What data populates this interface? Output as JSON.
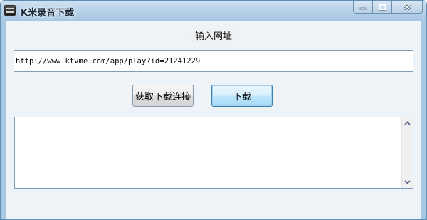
{
  "window": {
    "title": "K米录音下载",
    "icon": "app-icon"
  },
  "form": {
    "url_label": "输入网址",
    "url_value": "http://www.ktvme.com/app/play?id=21241229",
    "get_link_button": "获取下载连接",
    "download_button": "下载",
    "output_text": ""
  },
  "colors": {
    "titlebar": "#b6d1e9",
    "client_background": "#eef3f8",
    "input_border": "#7e9db9",
    "focused_button": "#bee6fd"
  }
}
